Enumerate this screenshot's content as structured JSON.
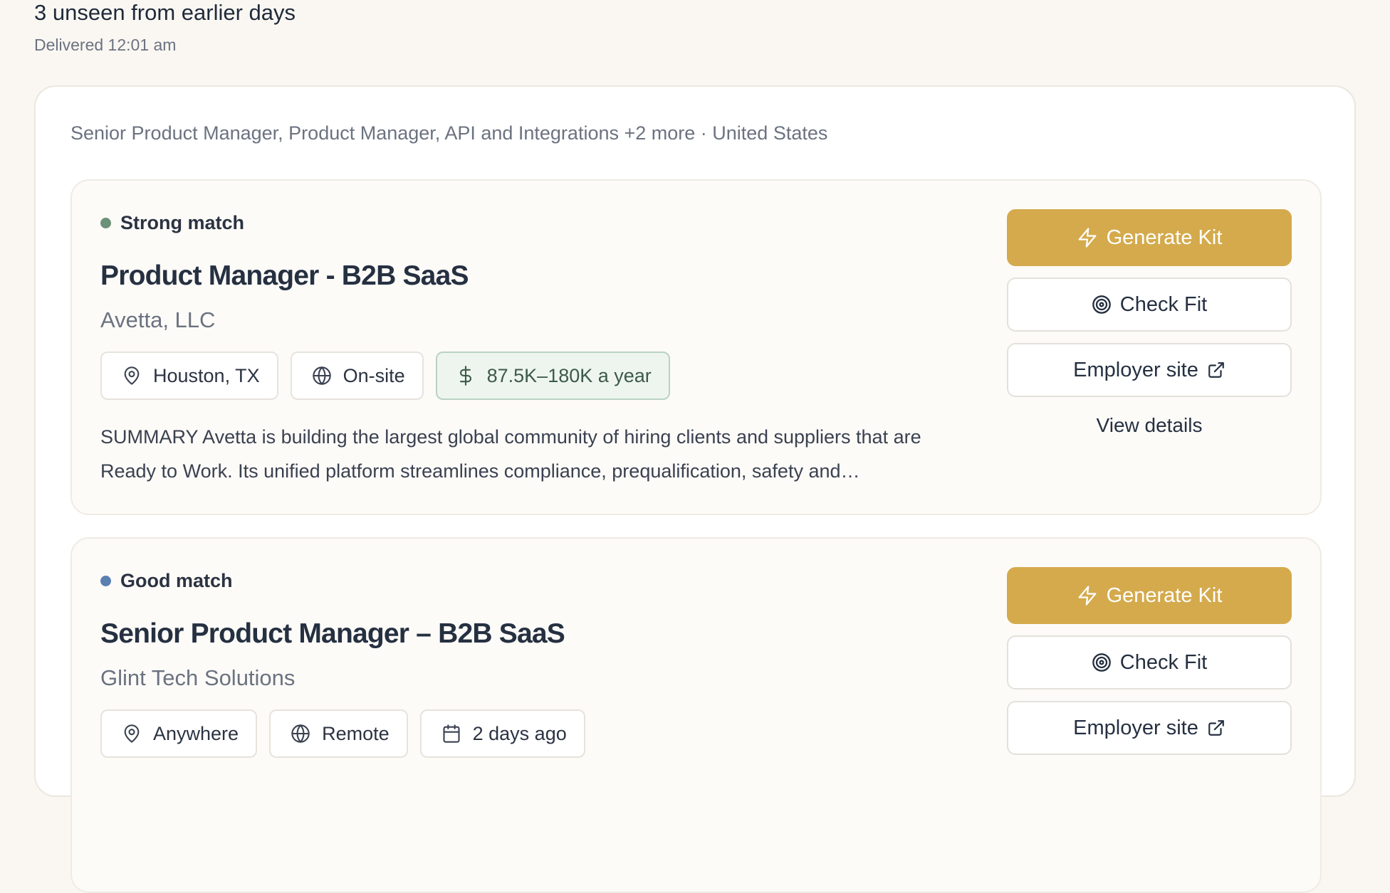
{
  "digest": {
    "title": "3 unseen from earlier days",
    "delivered": "Delivered 12:01 am"
  },
  "search": {
    "query": "Senior Product Manager, Product Manager, API and Integrations +2 more · United States"
  },
  "colors": {
    "strong_match": "#6b9178",
    "good_match": "#5b7fb0",
    "primary_button": "#d4aa4c"
  },
  "jobs": [
    {
      "match": "Strong match",
      "title": "Product Manager - B2B SaaS",
      "company": "Avetta, LLC",
      "chips": [
        {
          "icon": "map-pin-icon",
          "text": "Houston, TX"
        },
        {
          "icon": "globe-icon",
          "text": "On-site"
        },
        {
          "icon": "dollar-icon",
          "text": "87.5K–180K a year"
        }
      ],
      "summary": "SUMMARY Avetta is building the largest global community of hiring clients and suppliers that are Ready to Work. Its unified platform streamlines compliance, prequalification, safety and…",
      "actions": {
        "generate": "Generate Kit",
        "check_fit": "Check Fit",
        "employer_site": "Employer site",
        "view_details": "View details"
      }
    },
    {
      "match": "Good match",
      "title": "Senior Product Manager – B2B SaaS",
      "company": "Glint Tech Solutions",
      "chips": [
        {
          "icon": "map-pin-icon",
          "text": "Anywhere"
        },
        {
          "icon": "globe-icon",
          "text": "Remote"
        },
        {
          "icon": "calendar-icon",
          "text": "2 days ago"
        }
      ],
      "actions": {
        "generate": "Generate Kit",
        "check_fit": "Check Fit",
        "employer_site": "Employer site"
      }
    }
  ]
}
